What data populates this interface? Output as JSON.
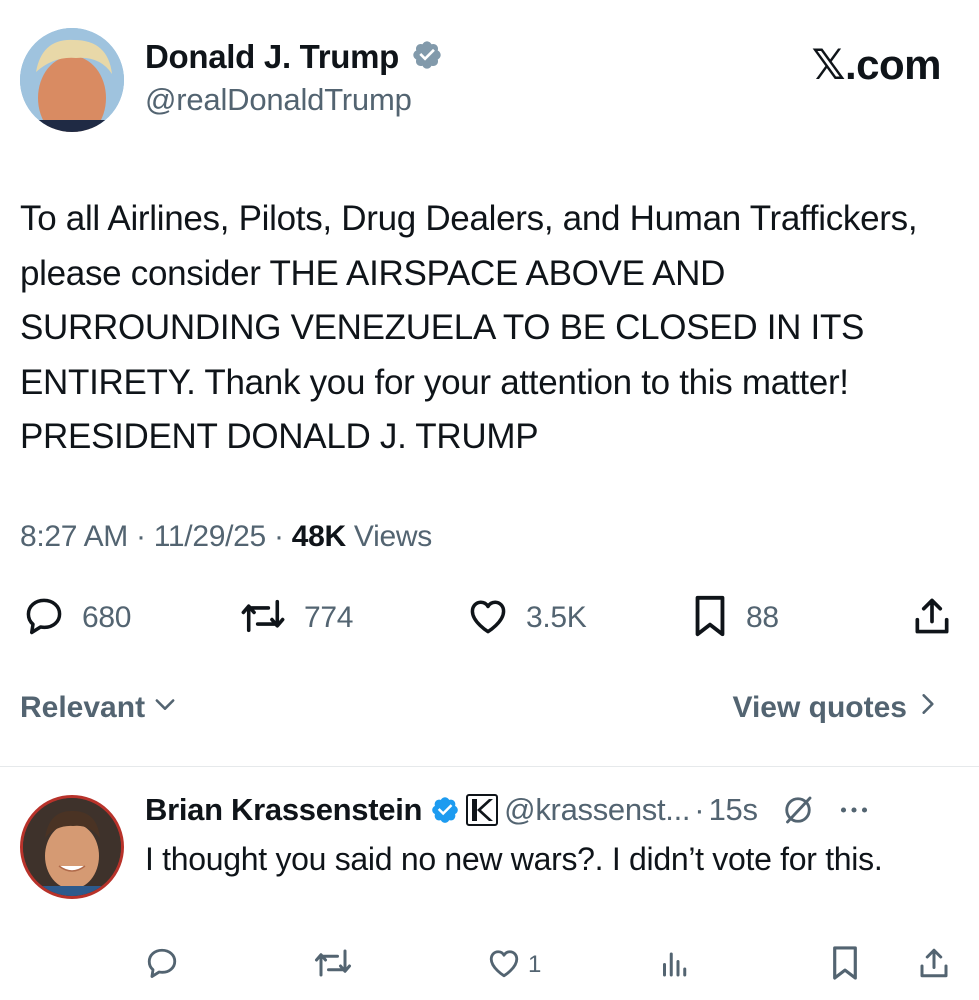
{
  "tweet": {
    "author": {
      "display_name": "Donald J. Trump",
      "handle": "@realDonaldTrump",
      "verified": true,
      "verified_color": "#829aab"
    },
    "site_mark": "𝕏.com",
    "text": "To all Airlines, Pilots, Drug Dealers, and Human Traffickers, please consider THE AIRSPACE ABOVE AND SURROUNDING VENEZUELA TO BE CLOSED IN ITS ENTIRETY. Thank you for your attention to this matter! PRESIDENT DONALD J. TRUMP",
    "time": "8:27 AM",
    "date": "11/29/25",
    "views_count": "48K",
    "views_label": "Views",
    "separator": "·",
    "stats": {
      "replies": "680",
      "reposts": "774",
      "likes": "3.5K",
      "bookmarks": "88"
    }
  },
  "sort": {
    "relevant_label": "Relevant",
    "view_quotes_label": "View quotes"
  },
  "reply": {
    "display_name": "Brian Krassenstein",
    "verified_color": "#1d9bf0",
    "handle": "@krassenst...",
    "separator": "·",
    "time": "15s",
    "text": "I thought you said no new wars?. I didn’t vote for this.",
    "stats": {
      "likes": "1"
    }
  },
  "colors": {
    "text_primary": "#0f1419",
    "text_secondary": "#536471",
    "divider": "#e6e9eb",
    "accent_blue": "#1d9bf0"
  }
}
